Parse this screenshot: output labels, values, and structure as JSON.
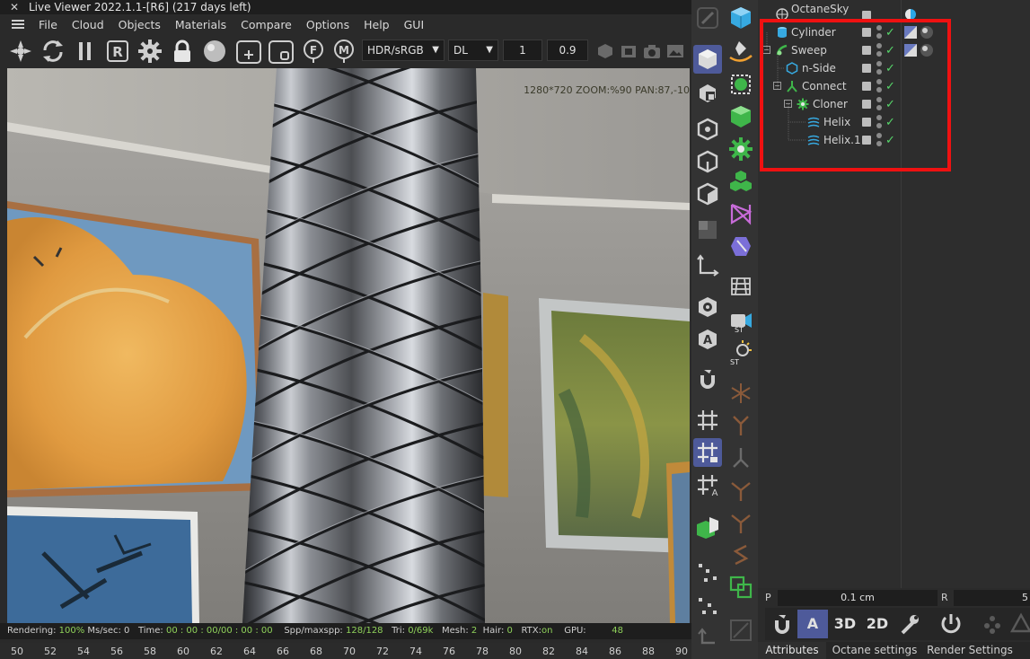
{
  "viewer": {
    "close_glyph": "✕",
    "title": "Live Viewer 2022.1.1-[R6] (217 days left)",
    "menu": [
      "File",
      "Cloud",
      "Objects",
      "Materials",
      "Compare",
      "Options",
      "Help",
      "GUI"
    ],
    "toolbar": {
      "r_label": "R",
      "f_label": "F",
      "m_label": "M",
      "colorspace": "HDR/sRGB",
      "kernel": "DL",
      "value_a": "1",
      "value_b": "0.9"
    },
    "stats": "1280*720 ZOOM:%90  PAN:87,-10",
    "status": {
      "rendering_label": "Rendering:",
      "rendering_value": "100%",
      "ms_label": "Ms/sec:",
      "ms_value": "0",
      "time_label": "Time:",
      "time_value": "00 : 00 : 00/00 : 00 : 00",
      "spp_label": "Spp/maxspp:",
      "spp_value": "128/128",
      "tri_label": "Tri:",
      "tri_value": "0/69k",
      "mesh_label": "Mesh:",
      "mesh_value": "2",
      "hair_label": "Hair:",
      "hair_value": "0",
      "rtx_label": "RTX:",
      "rtx_value": "on",
      "gpu_label": "GPU:",
      "gpu_value": "48"
    },
    "ruler": [
      "50",
      "52",
      "54",
      "56",
      "58",
      "60",
      "62",
      "64",
      "66",
      "68",
      "70",
      "72",
      "74",
      "76",
      "78",
      "80",
      "82",
      "84",
      "86",
      "88",
      "90"
    ]
  },
  "object_manager": {
    "objects": [
      {
        "name": "OctaneSky",
        "level": 0,
        "icon": "sky-icon"
      },
      {
        "name": "Cylinder",
        "level": 0,
        "icon": "cylinder-icon"
      },
      {
        "name": "Sweep",
        "level": 0,
        "icon": "sweep-icon",
        "expand": "⊟"
      },
      {
        "name": "n-Side",
        "level": 1,
        "icon": "nside-icon"
      },
      {
        "name": "Connect",
        "level": 1,
        "icon": "connect-icon",
        "expand": "⊟"
      },
      {
        "name": "Cloner",
        "level": 2,
        "icon": "cloner-icon",
        "expand": "⊟"
      },
      {
        "name": "Helix",
        "level": 3,
        "icon": "helix-icon"
      },
      {
        "name": "Helix.1",
        "level": 3,
        "icon": "helix-icon"
      }
    ],
    "check_glyph": "✓"
  },
  "attributes": {
    "p_label": "P",
    "p_value": "0.1 cm",
    "r_label": "R",
    "r_value": "5",
    "tool_a": "A",
    "tool_3d": "3D",
    "tool_2d": "2D",
    "tabs": [
      "Attributes",
      "Octane settings",
      "Render Settings"
    ]
  },
  "colors": {
    "accent": "#4e5a9a",
    "highlight_box": "#ef1111",
    "check": "#56d66a",
    "status_green": "#8fd15a"
  }
}
